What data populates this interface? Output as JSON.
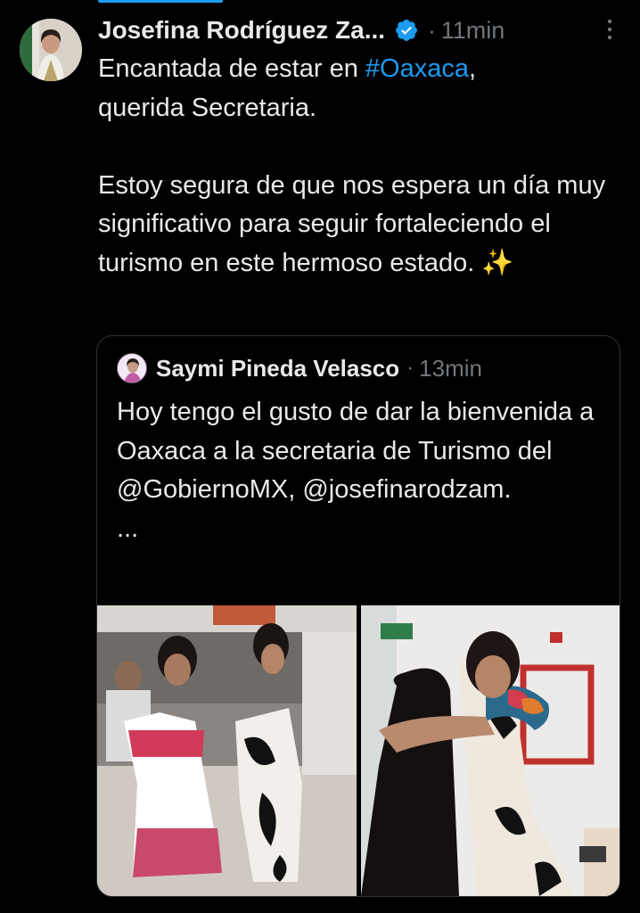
{
  "post": {
    "author": "Josefina Rodríguez Za...",
    "dot": "·",
    "time": "11min",
    "hashtag": "#Oaxaca",
    "text_before_hashtag": "Encantada de estar en ",
    "text_after_hashtag": ",\nquerida Secretaria.\n\nEstoy segura de que nos espera un día muy significativo para seguir fortaleciendo el turismo en este hermoso estado. ✨",
    "verified_icon": "verified-badge-icon",
    "more_icon": "more-vertical-icon"
  },
  "quote": {
    "author": "Saymi Pineda Velasco",
    "dot": "·",
    "time": "13min",
    "text": "Hoy tengo el gusto de dar la bienvenida a Oaxaca a la secretaria de Turismo del @GobiernoMX, @josefinarodzam.\n..."
  },
  "colors": {
    "background": "#000000",
    "text": "#e7e9ea",
    "muted": "#71767b",
    "link": "#1d9bf0",
    "border": "#2f3336"
  }
}
